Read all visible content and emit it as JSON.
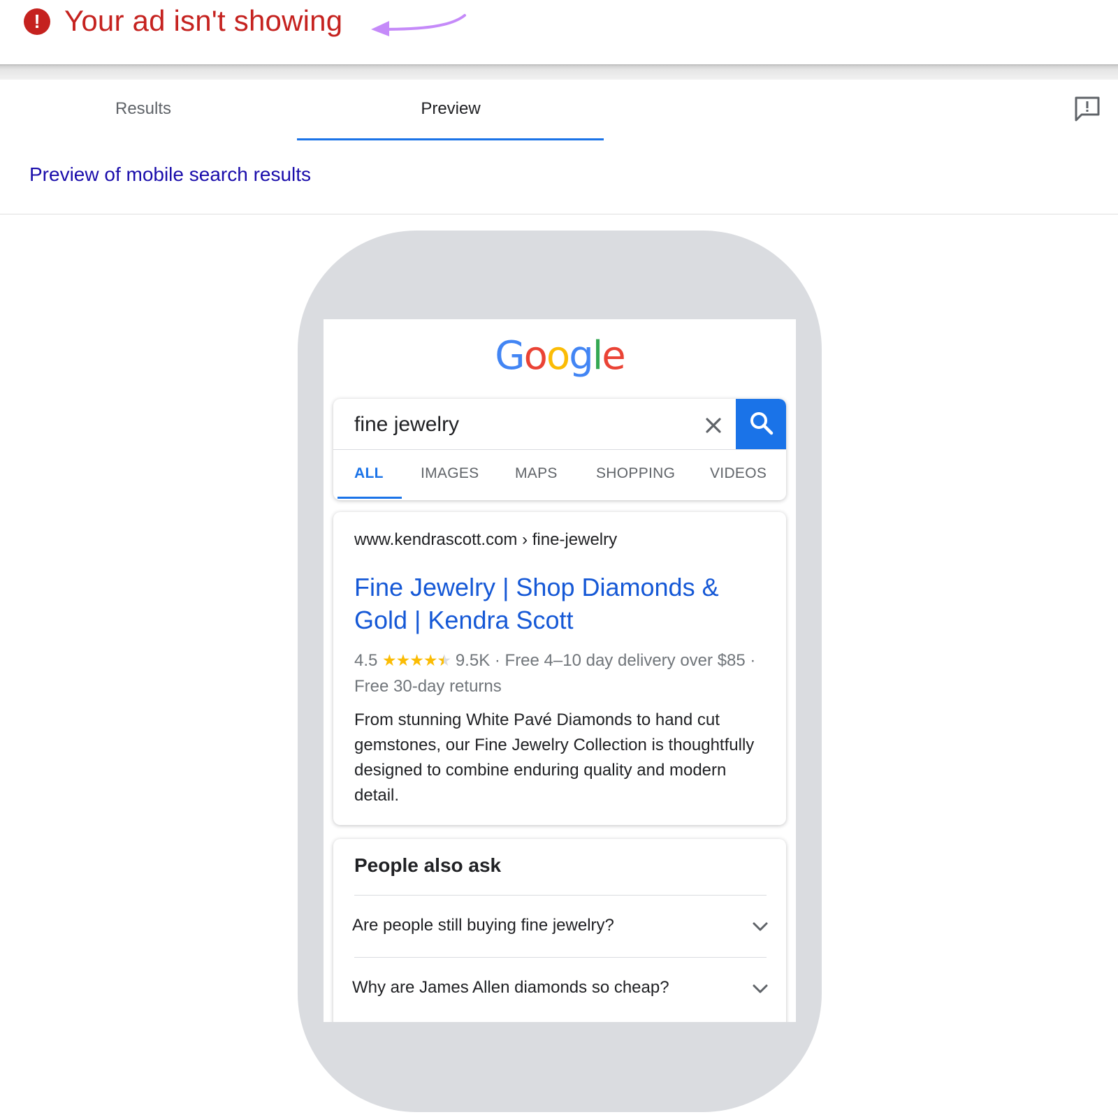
{
  "status": {
    "icon": "error-icon",
    "icon_glyph": "!",
    "text": "Your ad isn't showing",
    "arrow_color": "#c58af9",
    "text_color": "#c5221f"
  },
  "tabs": [
    {
      "label": "Results",
      "active": false
    },
    {
      "label": "Preview",
      "active": true
    }
  ],
  "feedback_icon": "feedback-icon",
  "preview_label": "Preview of mobile search results",
  "phone": {
    "logo": {
      "letters": [
        "G",
        "o",
        "o",
        "g",
        "l",
        "e"
      ]
    },
    "search": {
      "query": "fine jewelry",
      "clear_icon": "close-icon",
      "search_icon": "search-icon",
      "tabs": [
        "ALL",
        "IMAGES",
        "MAPS",
        "SHOPPING",
        "VIDEOS"
      ],
      "active_tab": "ALL"
    },
    "result": {
      "url": "www.kendrascott.com › fine-jewelry",
      "title": "Fine Jewelry | Shop Diamonds & Gold | Kendra Scott",
      "rating": "4.5",
      "stars_full": "★★★★",
      "star_half": "★",
      "reviews": "9.5K",
      "meta_rest": " · Free 4–10 day delivery over $85 · Free 30-day returns",
      "description": "From stunning White Pavé Diamonds to hand cut gemstones, our Fine Jewelry Collection is thoughtfully designed to combine enduring quality and modern detail."
    },
    "paa": {
      "title": "People also ask",
      "questions": [
        "Are people still buying fine jewelry?",
        "Why are James Allen diamonds so cheap?"
      ]
    }
  },
  "colors": {
    "accent": "#1a73e8",
    "link": "#1a0dab",
    "phone_frame": "#dadce0",
    "star": "#fbbc04"
  }
}
